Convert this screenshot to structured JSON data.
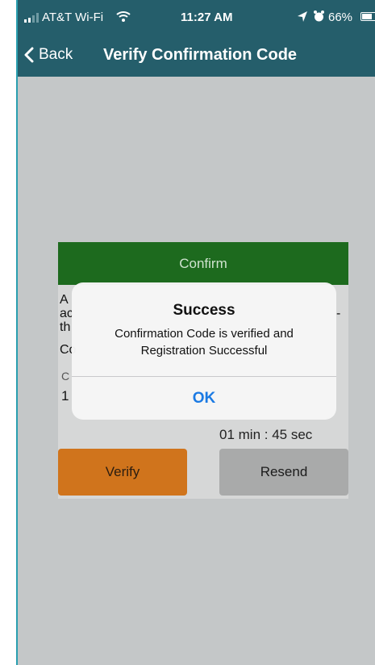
{
  "status_bar": {
    "carrier": "AT&T Wi-Fi",
    "time": "11:27 AM",
    "battery": "66%",
    "battery_level": 0.66
  },
  "nav": {
    "back_label": "Back",
    "title": "Verify Confirmation Code"
  },
  "card": {
    "header": "Confirm",
    "partial_lines": [
      "A",
      "ac",
      "th",
      "Co",
      "C",
      "1"
    ],
    "partial_dash": "-",
    "timer": "01 min : 45 sec",
    "verify_label": "Verify",
    "resend_label": "Resend"
  },
  "alert": {
    "title": "Success",
    "message": "Confirmation Code is verified and Registration Successful",
    "ok_label": "OK"
  },
  "colors": {
    "nav_bg": "#255e6b",
    "confirm_green": "#1d6a1e",
    "verify_orange": "#d0741c",
    "resend_gray": "#a9aaaa",
    "alert_link_blue": "#1b7ae3"
  }
}
